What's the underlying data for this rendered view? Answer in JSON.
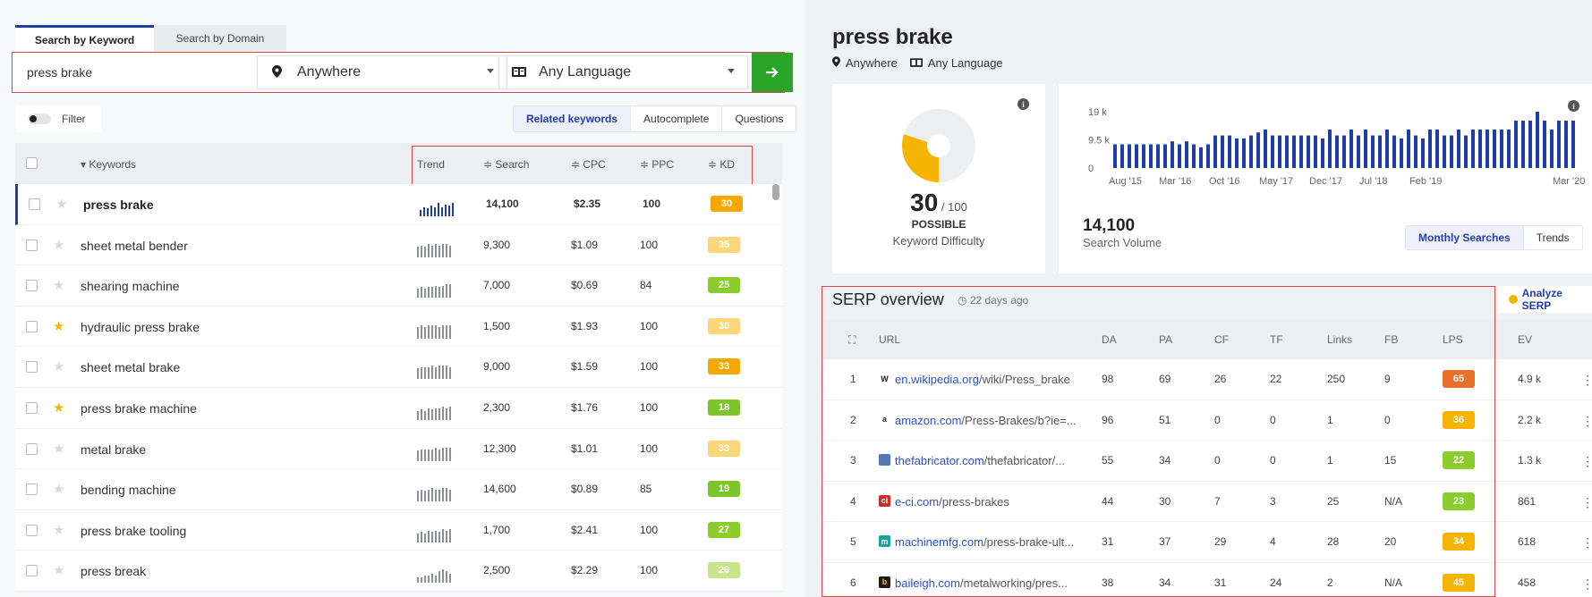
{
  "search_tabs": [
    "Search by Keyword",
    "Search by Domain"
  ],
  "search": {
    "keyword": "press brake",
    "location": "Anywhere",
    "language": "Any Language",
    "go_icon": "arrow-right-icon"
  },
  "filter_label": "Filter",
  "keyword_tabs": [
    "Related keywords",
    "Autocomplete",
    "Questions"
  ],
  "keyword_table": {
    "headers": [
      "Keywords",
      "Trend",
      "Search",
      "CPC",
      "PPC",
      "KD"
    ],
    "rows": [
      {
        "keyword": "press brake",
        "starred": false,
        "search": "14,100",
        "cpc": "$2.35",
        "ppc": "100",
        "kd": "30",
        "kd_color": "#f5a800",
        "trend": [
          4,
          6,
          5,
          7,
          6,
          9,
          6,
          8,
          7,
          9
        ]
      },
      {
        "keyword": "sheet metal bender",
        "starred": false,
        "search": "9,300",
        "cpc": "$1.09",
        "ppc": "100",
        "kd": "35",
        "kd_color": "#fcd67a",
        "trend": [
          7,
          8,
          7,
          9,
          8,
          9,
          8,
          9,
          9,
          8
        ]
      },
      {
        "keyword": "shearing machine",
        "starred": false,
        "search": "7,000",
        "cpc": "$0.69",
        "ppc": "84",
        "kd": "25",
        "kd_color": "#8ccc2c",
        "trend": [
          5,
          6,
          5,
          6,
          6,
          7,
          6,
          7,
          8,
          8
        ]
      },
      {
        "keyword": "hydraulic press brake",
        "starred": true,
        "search": "1,500",
        "cpc": "$1.93",
        "ppc": "100",
        "kd": "30",
        "kd_color": "#fcd67a",
        "trend": [
          8,
          9,
          8,
          9,
          9,
          9,
          8,
          9,
          9,
          9
        ]
      },
      {
        "keyword": "sheet metal brake",
        "starred": false,
        "search": "9,000",
        "cpc": "$1.59",
        "ppc": "100",
        "kd": "33",
        "kd_color": "#f5a800",
        "trend": [
          7,
          8,
          8,
          8,
          9,
          8,
          9,
          9,
          9,
          8
        ]
      },
      {
        "keyword": "press brake machine",
        "starred": true,
        "search": "2,300",
        "cpc": "$1.76",
        "ppc": "100",
        "kd": "18",
        "kd_color": "#7cc52a",
        "trend": [
          5,
          6,
          5,
          7,
          6,
          7,
          7,
          8,
          7,
          8
        ]
      },
      {
        "keyword": "metal brake",
        "starred": false,
        "search": "12,300",
        "cpc": "$1.01",
        "ppc": "100",
        "kd": "33",
        "kd_color": "#fcd67a",
        "trend": [
          6,
          7,
          7,
          7,
          7,
          8,
          7,
          8,
          8,
          8
        ]
      },
      {
        "keyword": "bending machine",
        "starred": false,
        "search": "14,600",
        "cpc": "$0.89",
        "ppc": "85",
        "kd": "19",
        "kd_color": "#7cc52a",
        "trend": [
          6,
          7,
          6,
          7,
          8,
          7,
          7,
          8,
          8,
          7
        ]
      },
      {
        "keyword": "press brake tooling",
        "starred": false,
        "search": "1,700",
        "cpc": "$2.41",
        "ppc": "100",
        "kd": "27",
        "kd_color": "#8ccc2c",
        "trend": [
          6,
          7,
          6,
          8,
          7,
          8,
          7,
          9,
          8,
          9
        ]
      },
      {
        "keyword": "press break",
        "starred": false,
        "search": "2,500",
        "cpc": "$2.29",
        "ppc": "100",
        "kd": "26",
        "kd_color": "#c7e58a",
        "trend": [
          2,
          2,
          3,
          3,
          4,
          3,
          5,
          6,
          5,
          4
        ]
      }
    ]
  },
  "detail": {
    "title": "press brake",
    "location": "Anywhere",
    "language": "Any Language",
    "kd_value": "30",
    "kd_max": "/ 100",
    "kd_level": "POSSIBLE",
    "kd_label": "Keyword Difficulty",
    "kd_fraction": 0.3,
    "search_volume": "14,100",
    "search_volume_label": "Search Volume",
    "volume_tabs": [
      "Monthly Searches",
      "Trends"
    ]
  },
  "chart_data": {
    "type": "bar",
    "y_ticks": [
      "0",
      "9.5 k",
      "19 k"
    ],
    "ylim": [
      0,
      19000
    ],
    "x_tick_labels": [
      "Aug '15",
      "Mar '16",
      "Oct '16",
      "May '17",
      "Dec '17",
      "Jul '18",
      "Feb '19",
      "Mar '20"
    ],
    "values": [
      8000,
      8000,
      8000,
      8000,
      8000,
      8000,
      8000,
      8000,
      9000,
      8000,
      9000,
      8000,
      7000,
      8000,
      11000,
      11000,
      11000,
      10000,
      10000,
      11000,
      12000,
      13000,
      11000,
      11000,
      11000,
      11000,
      11000,
      11000,
      11000,
      10000,
      13000,
      11000,
      11000,
      13000,
      11000,
      13000,
      11000,
      11000,
      13000,
      11000,
      10000,
      13000,
      11000,
      10000,
      13000,
      13000,
      11000,
      11000,
      13000,
      11000,
      13000,
      13000,
      13000,
      13000,
      13000,
      13000,
      16000,
      16000,
      16000,
      19000,
      16000,
      13000,
      16000,
      16000,
      16000
    ]
  },
  "serp": {
    "title": "SERP overview",
    "ago": "22 days ago",
    "analyze_label": "Analyze SERP",
    "headers": [
      "URL",
      "DA",
      "PA",
      "CF",
      "TF",
      "Links",
      "FB",
      "LPS",
      "EV"
    ],
    "rows": [
      {
        "n": "1",
        "fav": "W",
        "fav_bg": "#ffffff",
        "fav_fg": "#222",
        "domain": "en.wikipedia.org",
        "path": "/wiki/Press_brake",
        "da": "98",
        "pa": "69",
        "cf": "26",
        "tf": "22",
        "links": "250",
        "fb": "9",
        "lps": "65",
        "lps_color": "#e9702a",
        "ev": "4.9 k"
      },
      {
        "n": "2",
        "fav": "a",
        "fav_bg": "#ffffff",
        "fav_fg": "#222",
        "domain": "amazon.com",
        "path": "/Press-Brakes/b?ie=...",
        "da": "96",
        "pa": "51",
        "cf": "0",
        "tf": "0",
        "links": "1",
        "fb": "0",
        "lps": "36",
        "lps_color": "#f5b400",
        "ev": "2.2 k"
      },
      {
        "n": "3",
        "fav": "",
        "fav_bg": "#5877b8",
        "fav_fg": "#fff",
        "domain": "thefabricator.com",
        "path": "/thefabricator/...",
        "da": "55",
        "pa": "34",
        "cf": "0",
        "tf": "0",
        "links": "1",
        "fb": "15",
        "lps": "22",
        "lps_color": "#8ccc2c",
        "ev": "1.3 k"
      },
      {
        "n": "4",
        "fav": "ci",
        "fav_bg": "#c9302c",
        "fav_fg": "#fff",
        "domain": "e-ci.com",
        "path": "/press-brakes",
        "da": "44",
        "pa": "30",
        "cf": "7",
        "tf": "3",
        "links": "25",
        "fb": "N/A",
        "lps": "23",
        "lps_color": "#8ccc2c",
        "ev": "861"
      },
      {
        "n": "5",
        "fav": "m",
        "fav_bg": "#1aa39b",
        "fav_fg": "#fff",
        "domain": "machinemfg.com",
        "path": "/press-brake-ult...",
        "da": "31",
        "pa": "37",
        "cf": "29",
        "tf": "4",
        "links": "28",
        "fb": "20",
        "lps": "34",
        "lps_color": "#f5b400",
        "ev": "618"
      },
      {
        "n": "6",
        "fav": "b",
        "fav_bg": "#1c1c1c",
        "fav_fg": "#f2c200",
        "domain": "baileigh.com",
        "path": "/metalworking/pres...",
        "da": "38",
        "pa": "34",
        "cf": "31",
        "tf": "24",
        "links": "2",
        "fb": "N/A",
        "lps": "45",
        "lps_color": "#f5b400",
        "ev": "458"
      }
    ]
  }
}
